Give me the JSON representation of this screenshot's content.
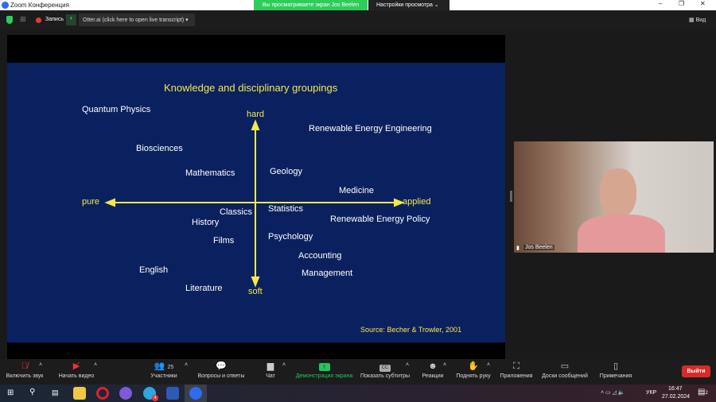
{
  "window": {
    "title": "Zoom Конференция",
    "sharing_banner": "Вы просматриваете экран Jos Beelen",
    "view_settings": "Настройки просмотра"
  },
  "top_toolbar": {
    "record": "Запись",
    "otter": "Otter.ai (click here to open live transcript)",
    "view": "Вид"
  },
  "slide": {
    "title": "Knowledge and disciplinary groupings",
    "axes": {
      "top": "hard",
      "bottom": "soft",
      "left": "pure",
      "right": "applied"
    },
    "items": [
      "Quantum Physics",
      "Renewable Energy Engineering",
      "Biosciences",
      "Mathematics",
      "Geology",
      "Medicine",
      "Classics",
      "Statistics",
      "History",
      "Renewable Energy Policy",
      "Films",
      "Psychology",
      "Accounting",
      "English",
      "Management",
      "Literature"
    ],
    "source": "Source: Becher & Trowler, 2001"
  },
  "video": {
    "name": "Jos Beelen"
  },
  "meeting_bar": {
    "unmute": "Включить звук",
    "video": "Начать видео",
    "participants": "Участники",
    "participants_count": "25",
    "qa": "Вопросы и ответы",
    "chat": "Чат",
    "share": "Демонстрация экрана",
    "captions": "Показать субтитры",
    "reactions": "Реакции",
    "raise_hand": "Поднять руку",
    "apps": "Приложения",
    "whiteboards": "Доски сообщений",
    "notes": "Примечания",
    "leave": "Выйти",
    "cc": "CC"
  },
  "taskbar": {
    "lang": "УКР",
    "time": "16:47",
    "date": "27.02.2024",
    "telegram_badge": "4",
    "notif_badge": "2"
  },
  "colors": {
    "slide_bg": "#0b215f",
    "accent_yellow": "#f5e84a",
    "share_green": "#22c55e",
    "leave_red": "#d92a2a"
  }
}
